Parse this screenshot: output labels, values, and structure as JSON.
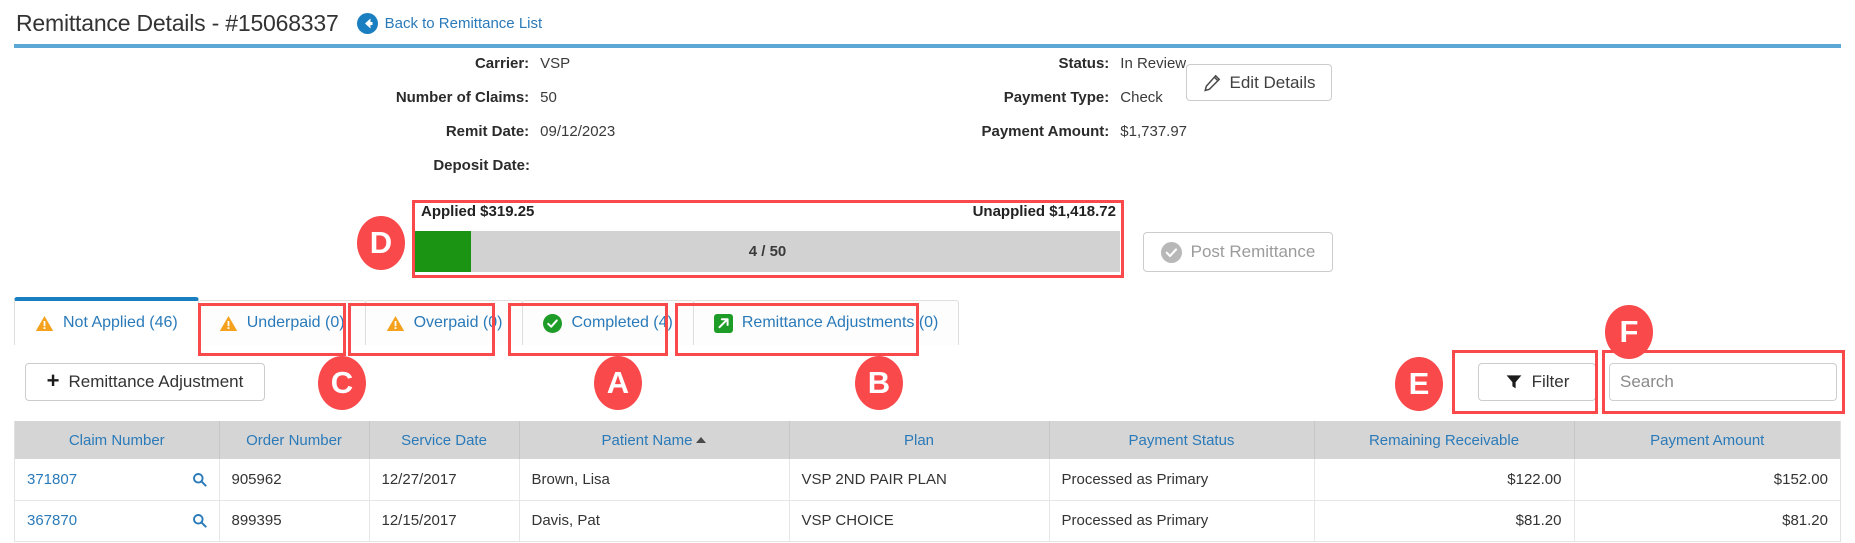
{
  "header": {
    "title": "Remittance Details - #15068337",
    "back_link": "Back to Remittance List",
    "back_icon": "back-arrow-circle-icon"
  },
  "details": {
    "left_column": [
      {
        "label": "Carrier:",
        "value": "VSP"
      },
      {
        "label": "Number of Claims:",
        "value": "50"
      },
      {
        "label": "Remit Date:",
        "value": "09/12/2023"
      },
      {
        "label": "Deposit Date:",
        "value": ""
      }
    ],
    "right_column": [
      {
        "label": "Status:",
        "value": "In Review"
      },
      {
        "label": "Payment Type:",
        "value": "Check"
      },
      {
        "label": "Payment Amount:",
        "value": "$1,737.97"
      }
    ],
    "edit_details_button": "Edit Details",
    "edit_details_icon": "pencil-icon"
  },
  "applied_panel": {
    "applied_label": "Applied $319.25",
    "unapplied_label": "Unapplied $1,418.72",
    "progress_text": "4 / 50",
    "progress_current": 4,
    "progress_total": 50,
    "progress_percent": 8,
    "fill_color": "#1a9412",
    "track_color": "#d2d2d2"
  },
  "post_remittance": {
    "label": "Post Remittance",
    "icon": "check-circle-icon",
    "disabled": true
  },
  "tabs": [
    {
      "label": "Not Applied (46)",
      "icon": "warning-triangle-icon",
      "active": true
    },
    {
      "label": "Underpaid (0)",
      "icon": "warning-triangle-icon",
      "active": false
    },
    {
      "label": "Overpaid (0)",
      "icon": "warning-triangle-icon",
      "active": false
    },
    {
      "label": "Completed (4)",
      "icon": "check-circle-green-icon",
      "active": false
    },
    {
      "label": "Remittance Adjustments (0)",
      "icon": "arrow-out-box-icon",
      "active": false
    }
  ],
  "toolbar": {
    "remittance_adjustment_label": "Remittance Adjustment",
    "remittance_adjustment_icon": "plus-icon",
    "filter_label": "Filter",
    "filter_icon": "funnel-icon",
    "search_placeholder": "Search",
    "search_value": ""
  },
  "table": {
    "columns": [
      "Claim Number",
      "Order Number",
      "Service Date",
      "Patient Name",
      "Plan",
      "Payment Status",
      "Remaining Receivable",
      "Payment Amount"
    ],
    "sorted_column": "Patient Name",
    "sort_direction": "asc",
    "rows": [
      {
        "claim_number": "371807",
        "order_number": "905962",
        "service_date": "12/27/2017",
        "patient_name": "Brown, Lisa",
        "plan": "VSP 2ND PAIR PLAN",
        "payment_status": "Processed as Primary",
        "remaining_receivable": "$122.00",
        "payment_amount": "$152.00"
      },
      {
        "claim_number": "367870",
        "order_number": "899395",
        "service_date": "12/15/2017",
        "patient_name": "Davis, Pat",
        "plan": "VSP CHOICE",
        "payment_status": "Processed as Primary",
        "remaining_receivable": "$81.20",
        "payment_amount": "$81.20"
      }
    ],
    "row_search_icon": "magnifier-icon"
  },
  "annotations": {
    "color": "#f9494b",
    "badges": [
      {
        "letter": "A"
      },
      {
        "letter": "B"
      },
      {
        "letter": "C"
      },
      {
        "letter": "D"
      },
      {
        "letter": "E"
      },
      {
        "letter": "F"
      }
    ]
  }
}
